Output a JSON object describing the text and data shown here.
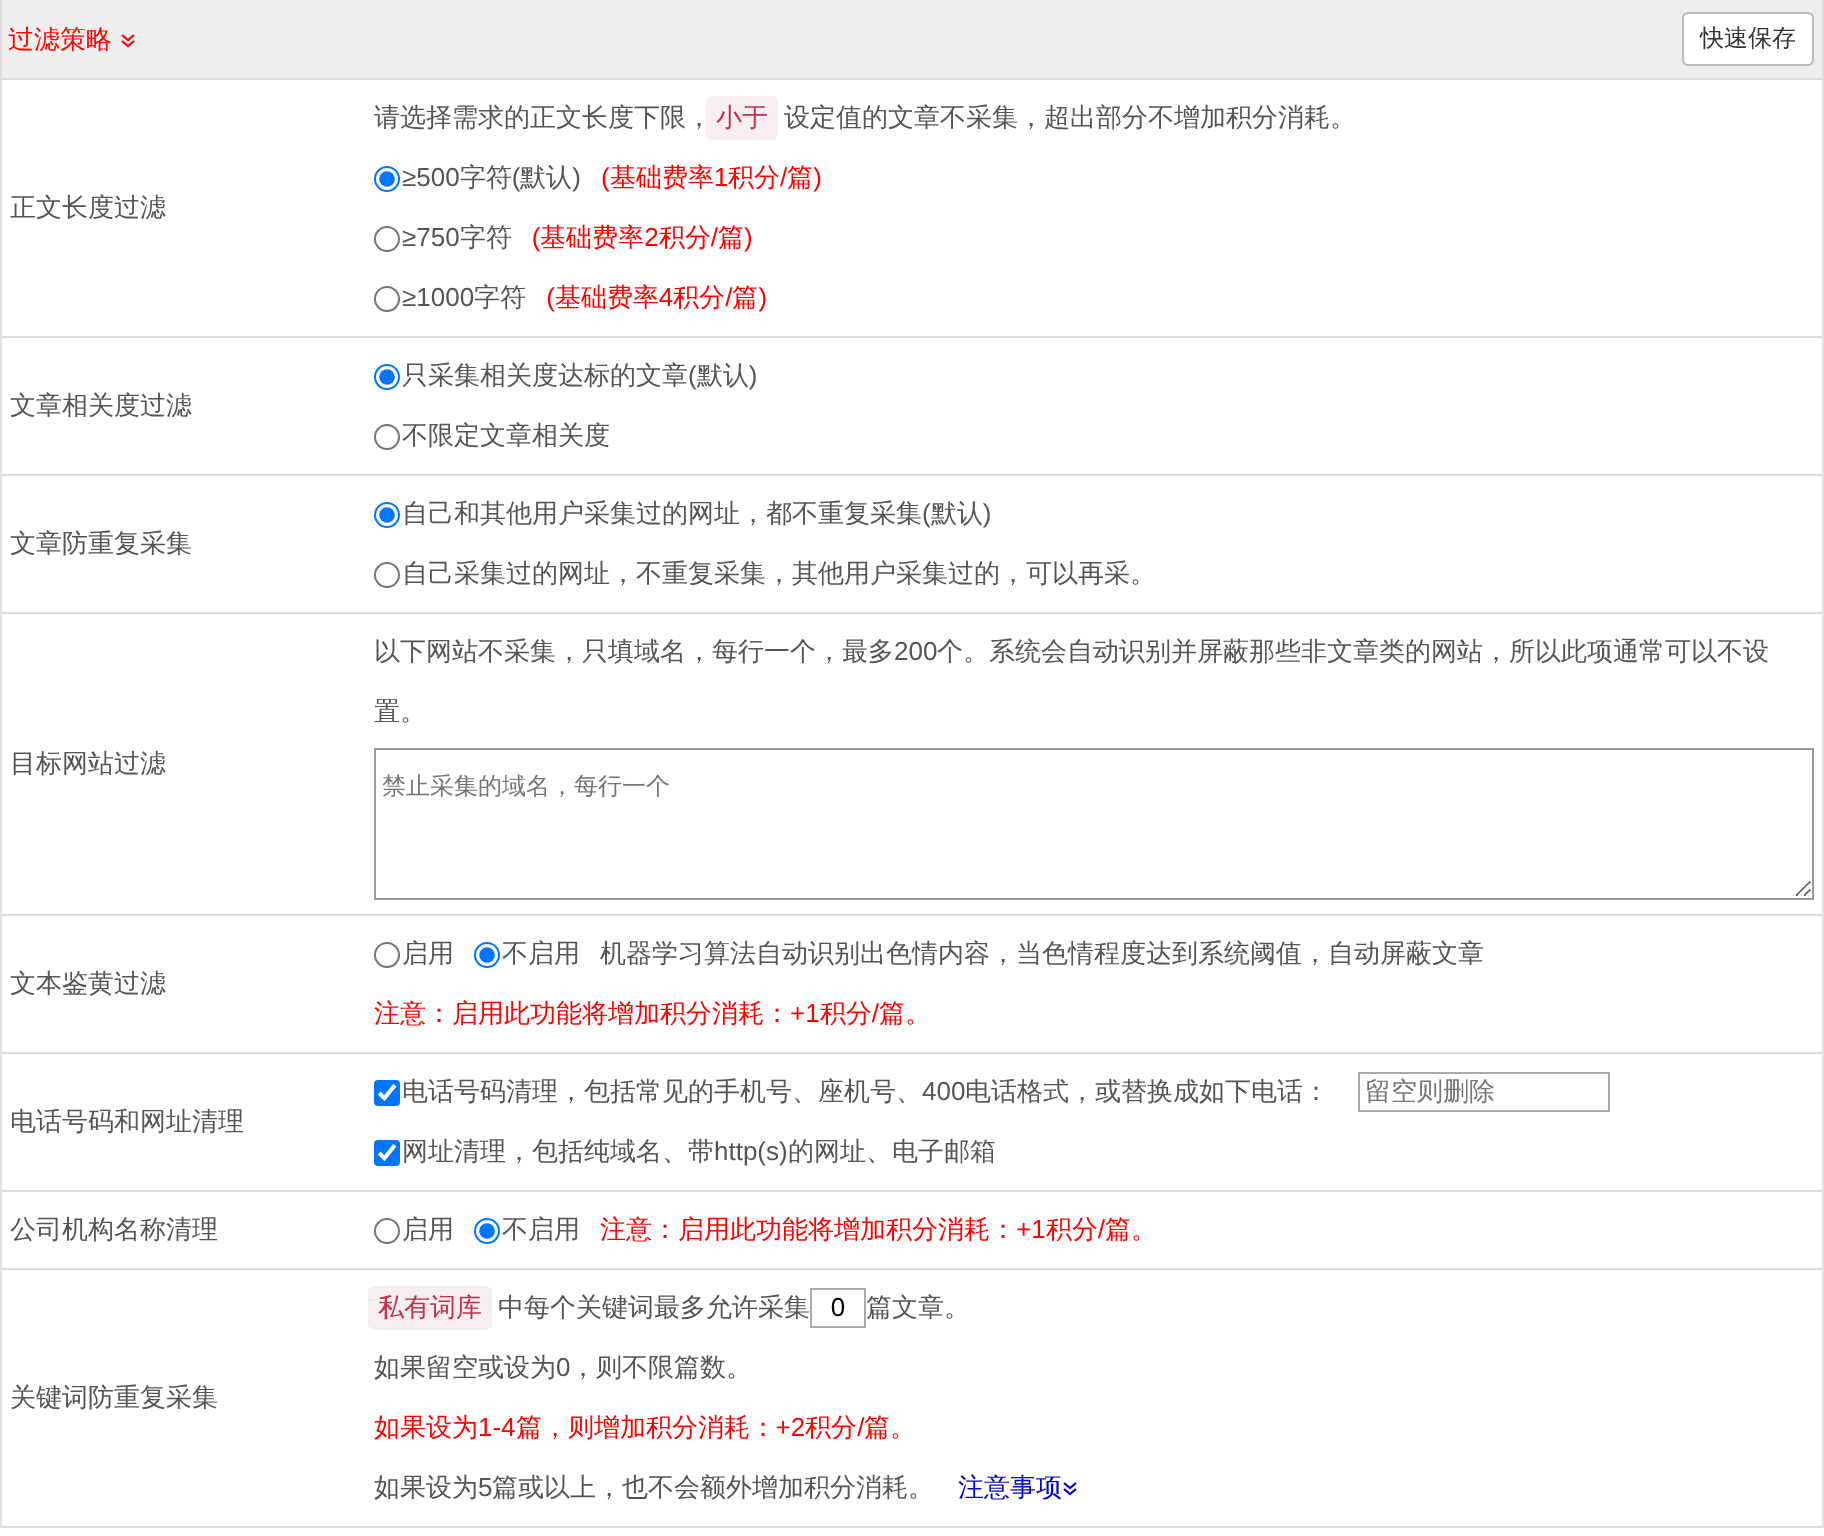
{
  "header": {
    "title": "过滤策略",
    "save_button": "快速保存"
  },
  "sections": [
    {
      "label": "正文长度过滤",
      "lines": [
        [
          {
            "kind": "text",
            "text": "请选择需求的正文长度下限，"
          },
          {
            "kind": "tag",
            "text": "小于"
          },
          {
            "kind": "text",
            "text": "设定值的文章不采集，超出部分不增加积分消耗。"
          }
        ],
        [
          {
            "kind": "radio",
            "text": "≥500字符(默认)",
            "selected": true
          },
          {
            "kind": "warn",
            "text": "(基础费率1积分/篇)"
          }
        ],
        [
          {
            "kind": "radio",
            "text": "≥750字符",
            "selected": false
          },
          {
            "kind": "warn",
            "text": "(基础费率2积分/篇)"
          }
        ],
        [
          {
            "kind": "radio",
            "text": "≥1000字符",
            "selected": false
          },
          {
            "kind": "warn",
            "text": "(基础费率4积分/篇)"
          }
        ]
      ]
    },
    {
      "label": "文章相关度过滤",
      "lines": [
        [
          {
            "kind": "radio",
            "text": "只采集相关度达标的文章(默认)",
            "selected": true
          }
        ],
        [
          {
            "kind": "radio",
            "text": "不限定文章相关度",
            "selected": false
          }
        ]
      ]
    },
    {
      "label": "文章防重复采集",
      "lines": [
        [
          {
            "kind": "radio",
            "text": "自己和其他用户采集过的网址，都不重复采集(默认)",
            "selected": true
          }
        ],
        [
          {
            "kind": "radio",
            "text": "自己采集过的网址，不重复采集，其他用户采集过的，可以再采。",
            "selected": false
          }
        ]
      ]
    },
    {
      "label": "目标网站过滤",
      "lines": [
        [
          {
            "kind": "text",
            "text": "以下网站不采集，只填域名，每行一个，最多200个。系统会自动识别并屏蔽那些非文章类的网站，所以此项通常可以不设置。"
          }
        ],
        [
          {
            "kind": "textarea",
            "placeholder": "禁止采集的域名，每行一个"
          }
        ]
      ]
    },
    {
      "label": "文本鉴黄过滤",
      "lines": [
        [
          {
            "kind": "radio",
            "text": "启用",
            "selected": false
          },
          {
            "kind": "radio",
            "text": "不启用",
            "selected": true
          },
          {
            "kind": "text",
            "text": "机器学习算法自动识别出色情内容，当色情程度达到系统阈值，自动屏蔽文章"
          }
        ],
        [
          {
            "kind": "warn",
            "text": "注意：启用此功能将增加积分消耗：+1积分/篇。"
          }
        ]
      ]
    },
    {
      "label": "电话号码和网址清理",
      "lines": [
        [
          {
            "kind": "checkbox",
            "text": "电话号码清理，包括常见的手机号、座机号、400电话格式，或替换成如下电话：",
            "checked": true
          },
          {
            "kind": "input",
            "placeholder": "留空则删除"
          }
        ],
        [
          {
            "kind": "checkbox",
            "text": "网址清理，包括纯域名、带http(s)的网址、电子邮箱",
            "checked": true
          }
        ]
      ]
    },
    {
      "label": "公司机构名称清理",
      "lines": [
        [
          {
            "kind": "radio",
            "text": "启用",
            "selected": false
          },
          {
            "kind": "radio",
            "text": "不启用",
            "selected": true
          },
          {
            "kind": "warn",
            "text": "注意：启用此功能将增加积分消耗：+1积分/篇。"
          }
        ]
      ]
    },
    {
      "label": "关键词防重复采集",
      "lines": [
        [
          {
            "kind": "tag",
            "text": "私有词库"
          },
          {
            "kind": "text",
            "text": "中每个关键词最多允许采集"
          },
          {
            "kind": "number",
            "value": "0"
          },
          {
            "kind": "text",
            "text": "篇文章。"
          }
        ],
        [
          {
            "kind": "text",
            "text": "如果留空或设为0，则不限篇数。"
          }
        ],
        [
          {
            "kind": "warn",
            "text": "如果设为1-4篇，则增加积分消耗：+2积分/篇。"
          }
        ],
        [
          {
            "kind": "text",
            "text": "如果设为5篇或以上，也不会额外增加积分消耗。"
          },
          {
            "kind": "link",
            "text": "注意事项"
          }
        ]
      ]
    }
  ]
}
